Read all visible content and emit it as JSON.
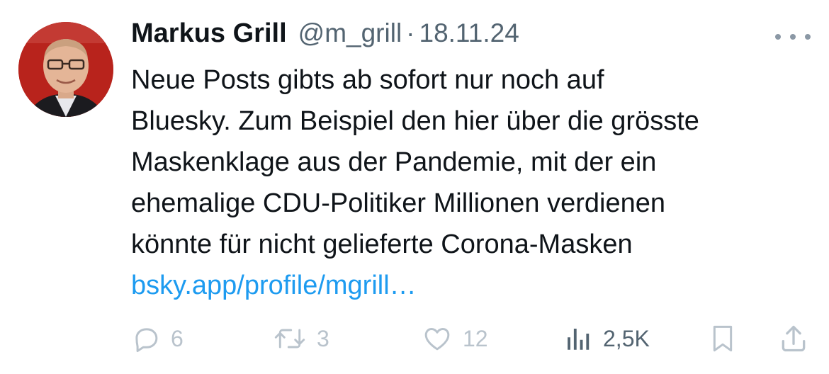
{
  "tweet": {
    "author_name": "Markus Grill",
    "handle": "@m_grill",
    "separator": "·",
    "date": "18.11.24",
    "text_lines": [
      "Neue Posts gibts ab sofort nur noch auf",
      "Bluesky. Zum Beispiel den hier über die grösste",
      "Maskenklage aus der Pandemie, mit der ein",
      "ehemalige CDU-Politiker Millionen verdienen",
      "könnte für nicht gelieferte Corona-Masken"
    ],
    "link_text": "bsky.app/profile/mgrill…"
  },
  "actions": {
    "replies": "6",
    "reposts": "3",
    "likes": "12",
    "views": "2,5K"
  },
  "icons": {
    "reply": "reply-icon",
    "repost": "retweet-icon",
    "like": "heart-icon",
    "views": "views-icon",
    "bookmark": "bookmark-icon",
    "share": "share-icon",
    "more": "more-icon"
  },
  "colors": {
    "text": "#0f1419",
    "secondary": "#536471",
    "link": "#1d9bf0",
    "muted_action": "#b9c3cc"
  }
}
